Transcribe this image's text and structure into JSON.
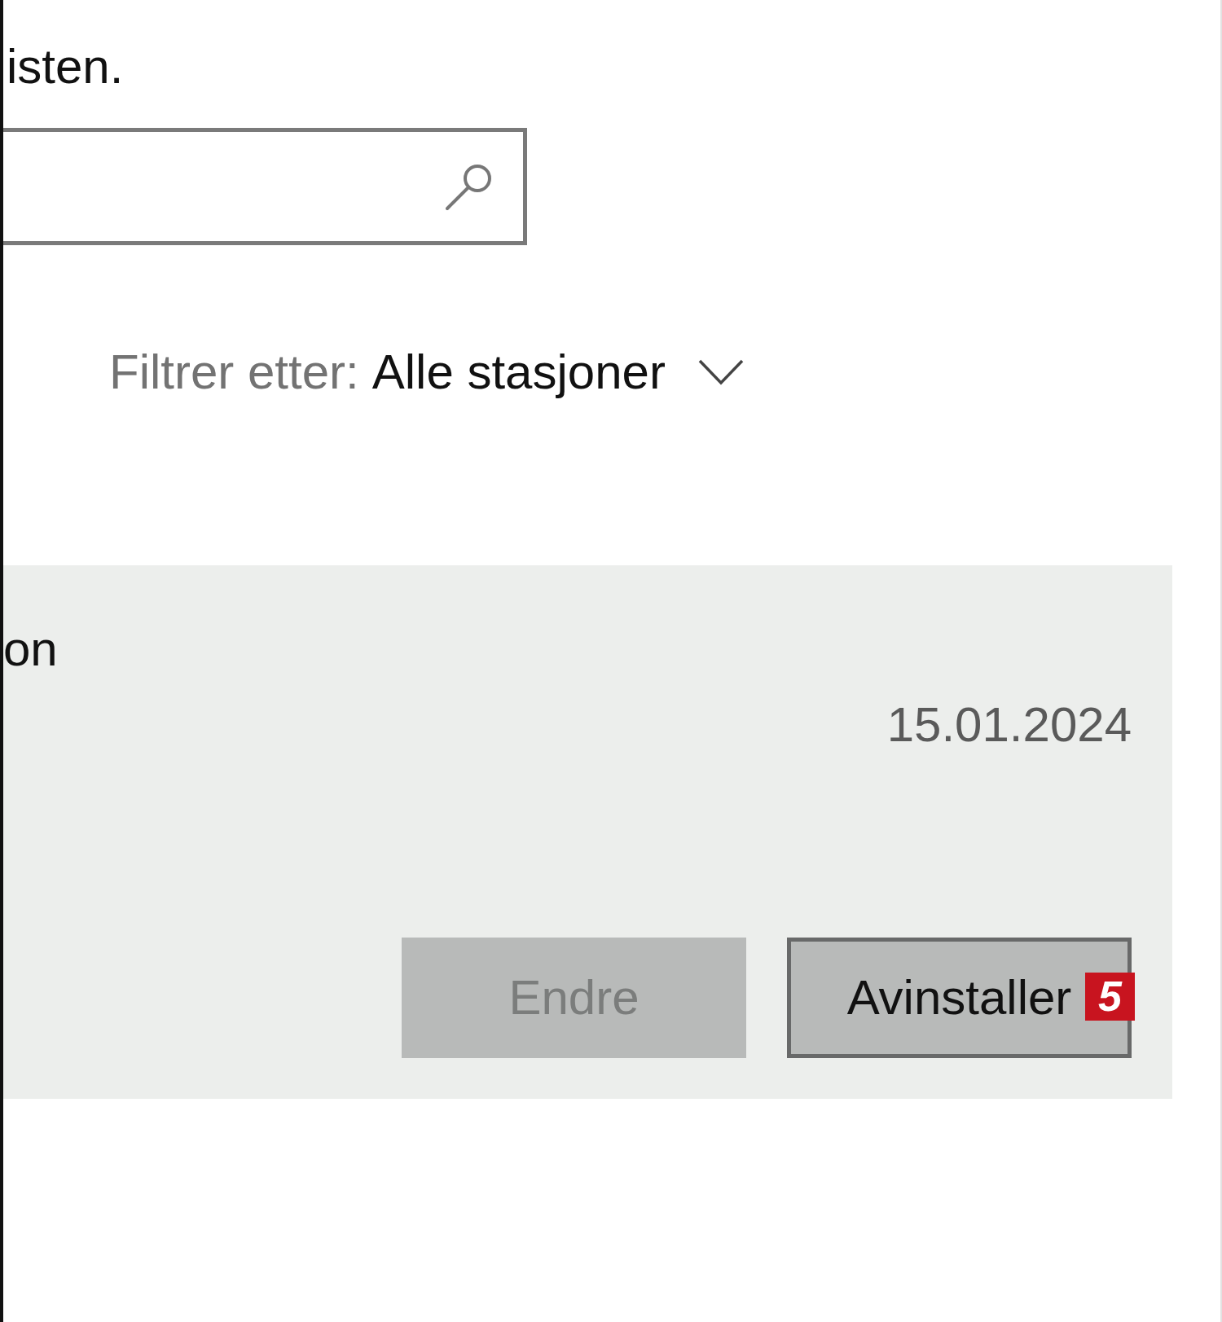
{
  "description": {
    "text": "isten."
  },
  "filter": {
    "label": "Filtrer etter:",
    "value": "Alle stasjoner"
  },
  "app": {
    "name": "on",
    "date": "15.01.2024",
    "selected": true,
    "buttons": [
      {
        "label": "Endre",
        "disabled": true,
        "focused": false
      },
      {
        "label": "Avinstaller",
        "disabled": false,
        "focused": true,
        "step_badge": "5"
      }
    ]
  }
}
